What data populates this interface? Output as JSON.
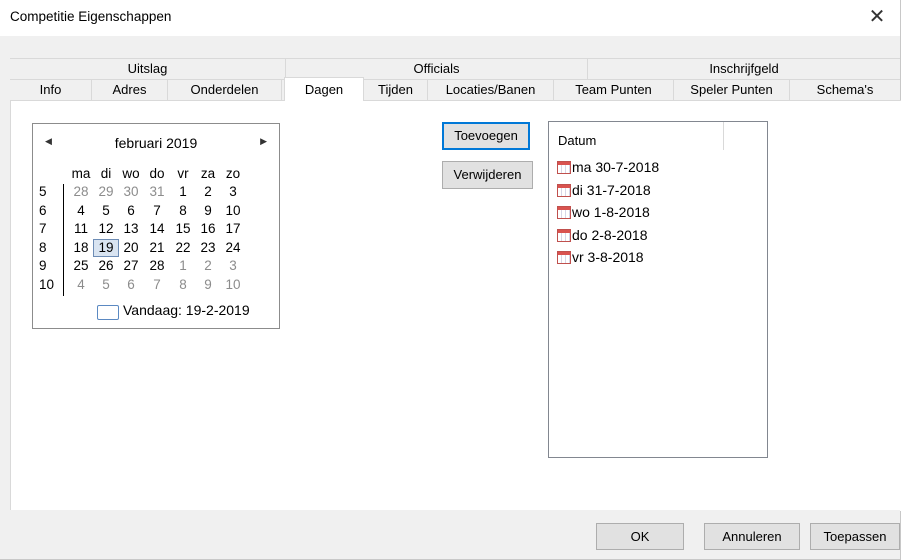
{
  "window": {
    "title": "Competitie Eigenschappen",
    "close_glyph": "✕"
  },
  "tabs_top": [
    "Uitslag",
    "Officials",
    "Inschrijfgeld"
  ],
  "tabs_bottom": [
    "Info",
    "Adres",
    "Onderdelen",
    "Dagen",
    "Tijden",
    "Locaties/Banen",
    "Team Punten",
    "Speler Punten",
    "Schema's"
  ],
  "active_tab": "Dagen",
  "calendar": {
    "month": "februari 2019",
    "prev_glyph": "◀",
    "next_glyph": "▶",
    "weekdays": [
      "ma",
      "di",
      "wo",
      "do",
      "vr",
      "za",
      "zo"
    ],
    "weeks": [
      {
        "week": "5",
        "days": [
          "28",
          "29",
          "30",
          "31",
          "1",
          "2",
          "3"
        ],
        "gray": [
          true,
          true,
          true,
          true,
          false,
          false,
          false
        ]
      },
      {
        "week": "6",
        "days": [
          "4",
          "5",
          "6",
          "7",
          "8",
          "9",
          "10"
        ],
        "gray": [
          false,
          false,
          false,
          false,
          false,
          false,
          false
        ]
      },
      {
        "week": "7",
        "days": [
          "11",
          "12",
          "13",
          "14",
          "15",
          "16",
          "17"
        ],
        "gray": [
          false,
          false,
          false,
          false,
          false,
          false,
          false
        ]
      },
      {
        "week": "8",
        "days": [
          "18",
          "19",
          "20",
          "21",
          "22",
          "23",
          "24"
        ],
        "gray": [
          false,
          false,
          false,
          false,
          false,
          false,
          false
        ]
      },
      {
        "week": "9",
        "days": [
          "25",
          "26",
          "27",
          "28",
          "1",
          "2",
          "3"
        ],
        "gray": [
          false,
          false,
          false,
          false,
          true,
          true,
          true
        ]
      },
      {
        "week": "10",
        "days": [
          "4",
          "5",
          "6",
          "7",
          "8",
          "9",
          "10"
        ],
        "gray": [
          true,
          true,
          true,
          true,
          true,
          true,
          true
        ]
      }
    ],
    "selected_day": "19",
    "today_label": "Vandaag: 19-2-2019"
  },
  "buttons": {
    "add": "Toevoegen",
    "remove": "Verwijderen"
  },
  "list": {
    "header": "Datum",
    "items": [
      "ma 30-7-2018",
      "di 31-7-2018",
      "wo 1-8-2018",
      "do 2-8-2018",
      "vr 3-8-2018"
    ],
    "item_icon": "calendar-icon"
  },
  "footer": {
    "ok": "OK",
    "cancel": "Annuleren",
    "apply": "Toepassen"
  }
}
